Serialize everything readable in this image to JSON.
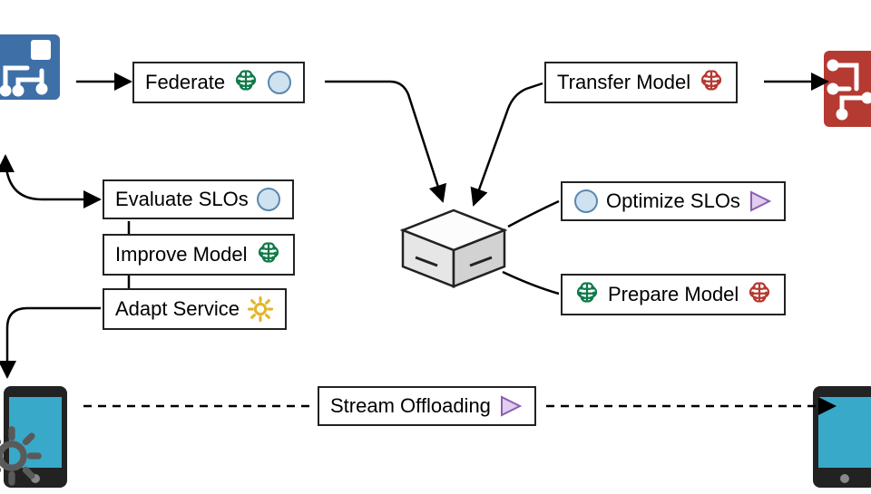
{
  "nodes": {
    "federate": {
      "label": "Federate"
    },
    "evaluate": {
      "label": "Evaluate SLOs"
    },
    "improve": {
      "label": "Improve Model"
    },
    "adapt": {
      "label": "Adapt Service"
    },
    "transfer": {
      "label": "Transfer Model"
    },
    "optimize": {
      "label": "Optimize SLOs"
    },
    "prepare": {
      "label": "Prepare Model"
    },
    "stream": {
      "label": "Stream Offloading"
    }
  },
  "icons": {
    "brain_green": "brain-icon",
    "brain_red": "brain-icon",
    "circle": "circle-icon",
    "triangle": "triangle-icon",
    "gear_yellow": "gear-icon",
    "gear_gray": "gear-icon",
    "edge_node": "edge-node-icon",
    "circuit": "circuit-icon",
    "phone": "phone-icon",
    "server": "server-icon"
  },
  "colors": {
    "brain_green": "#107a4a",
    "brain_red": "#b53a32",
    "circle": "#b7d3e8",
    "triangle": "#c9a9e0",
    "gear_yellow": "#e2b52a",
    "gear_gray": "#5a5a5a",
    "edge_blue": "#3e6fa7",
    "phone_blue": "#39a9c9"
  }
}
